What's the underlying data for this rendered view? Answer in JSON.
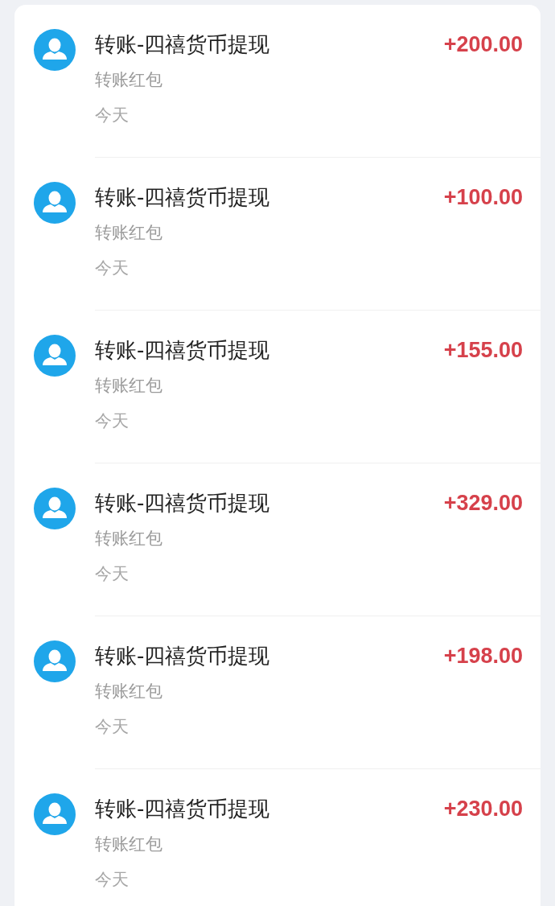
{
  "transactions": [
    {
      "title": "转账-四禧货币提现",
      "subtitle": "转账红包",
      "date": "今天",
      "amount": "+200.00"
    },
    {
      "title": "转账-四禧货币提现",
      "subtitle": "转账红包",
      "date": "今天",
      "amount": "+100.00"
    },
    {
      "title": "转账-四禧货币提现",
      "subtitle": "转账红包",
      "date": "今天",
      "amount": "+155.00"
    },
    {
      "title": "转账-四禧货币提现",
      "subtitle": "转账红包",
      "date": "今天",
      "amount": "+329.00"
    },
    {
      "title": "转账-四禧货币提现",
      "subtitle": "转账红包",
      "date": "今天",
      "amount": "+198.00"
    },
    {
      "title": "转账-四禧货币提现",
      "subtitle": "转账红包",
      "date": "今天",
      "amount": "+230.00"
    }
  ]
}
